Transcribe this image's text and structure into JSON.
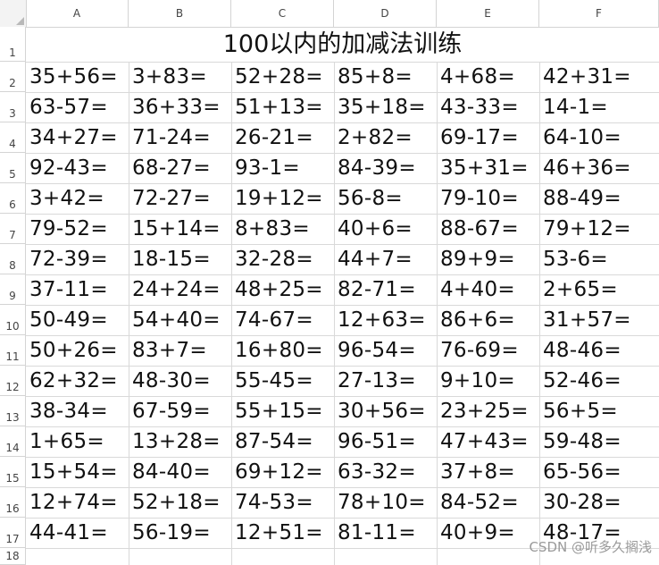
{
  "columns": [
    "A",
    "B",
    "C",
    "D",
    "E",
    "F"
  ],
  "rows": [
    "1",
    "2",
    "3",
    "4",
    "5",
    "6",
    "7",
    "8",
    "9",
    "10",
    "11",
    "12",
    "13",
    "14",
    "15",
    "16",
    "17",
    "18"
  ],
  "title": "100以内的加减法训练",
  "problems": [
    [
      "35+56=",
      "3+83=",
      "52+28=",
      "85+8=",
      "4+68=",
      "42+31="
    ],
    [
      "63-57=",
      "36+33=",
      "51+13=",
      "35+18=",
      "43-33=",
      "14-1="
    ],
    [
      "34+27=",
      "71-24=",
      "26-21=",
      "2+82=",
      "69-17=",
      "64-10="
    ],
    [
      "92-43=",
      "68-27=",
      "93-1=",
      "84-39=",
      "35+31=",
      "46+36="
    ],
    [
      "3+42=",
      "72-27=",
      "19+12=",
      "56-8=",
      "79-10=",
      "88-49="
    ],
    [
      "79-52=",
      "15+14=",
      "8+83=",
      "40+6=",
      "88-67=",
      "79+12="
    ],
    [
      "72-39=",
      "18-15=",
      "32-28=",
      "44+7=",
      "89+9=",
      "53-6="
    ],
    [
      "37-11=",
      "24+24=",
      "48+25=",
      "82-71=",
      "4+40=",
      "2+65="
    ],
    [
      "50-49=",
      "54+40=",
      "74-67=",
      "12+63=",
      "86+6=",
      "31+57="
    ],
    [
      "50+26=",
      "83+7=",
      "16+80=",
      "96-54=",
      "76-69=",
      "48-46="
    ],
    [
      "62+32=",
      "48-30=",
      "55-45=",
      "27-13=",
      "9+10=",
      "52-46="
    ],
    [
      "38-34=",
      "67-59=",
      "55+15=",
      "30+56=",
      "23+25=",
      "56+5="
    ],
    [
      "1+65=",
      "13+28=",
      "87-54=",
      "96-51=",
      "47+43=",
      "59-48="
    ],
    [
      "15+54=",
      "84-40=",
      "69+12=",
      "63-32=",
      "37+8=",
      "65-56="
    ],
    [
      "12+74=",
      "52+18=",
      "74-53=",
      "78+10=",
      "84-52=",
      "30-28="
    ],
    [
      "44-41=",
      "56-19=",
      "12+51=",
      "81-11=",
      "40+9=",
      "48-17="
    ]
  ],
  "watermark": "CSDN @听多久搁浅"
}
